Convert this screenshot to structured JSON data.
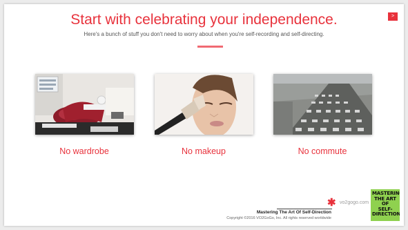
{
  "slide": {
    "title": "Start with celebrating your independence.",
    "subtitle": "Here's a bunch of stuff you don't need to worry about when you're self-recording and self-directing.",
    "next_label": ">",
    "accent_color": "#e8323c"
  },
  "items": [
    {
      "caption": "No wardrobe",
      "image": "cluttered-closet-photo"
    },
    {
      "caption": "No makeup",
      "image": "makeup-brush-face-photo"
    },
    {
      "caption": "No commute",
      "image": "traffic-jam-highway-photo"
    }
  ],
  "footer": {
    "logo_text": "vo2gogo.com",
    "logo_mark": "red-asterisk-icon",
    "course_title": "Mastering The Art Of Self-Direction",
    "copyright": "Copyright ©2016 VO2GoGo, Inc. All rights reserved worldwide",
    "book_title": "MASTERING\nTHE ART OF\nSELF-DIRECTION"
  }
}
